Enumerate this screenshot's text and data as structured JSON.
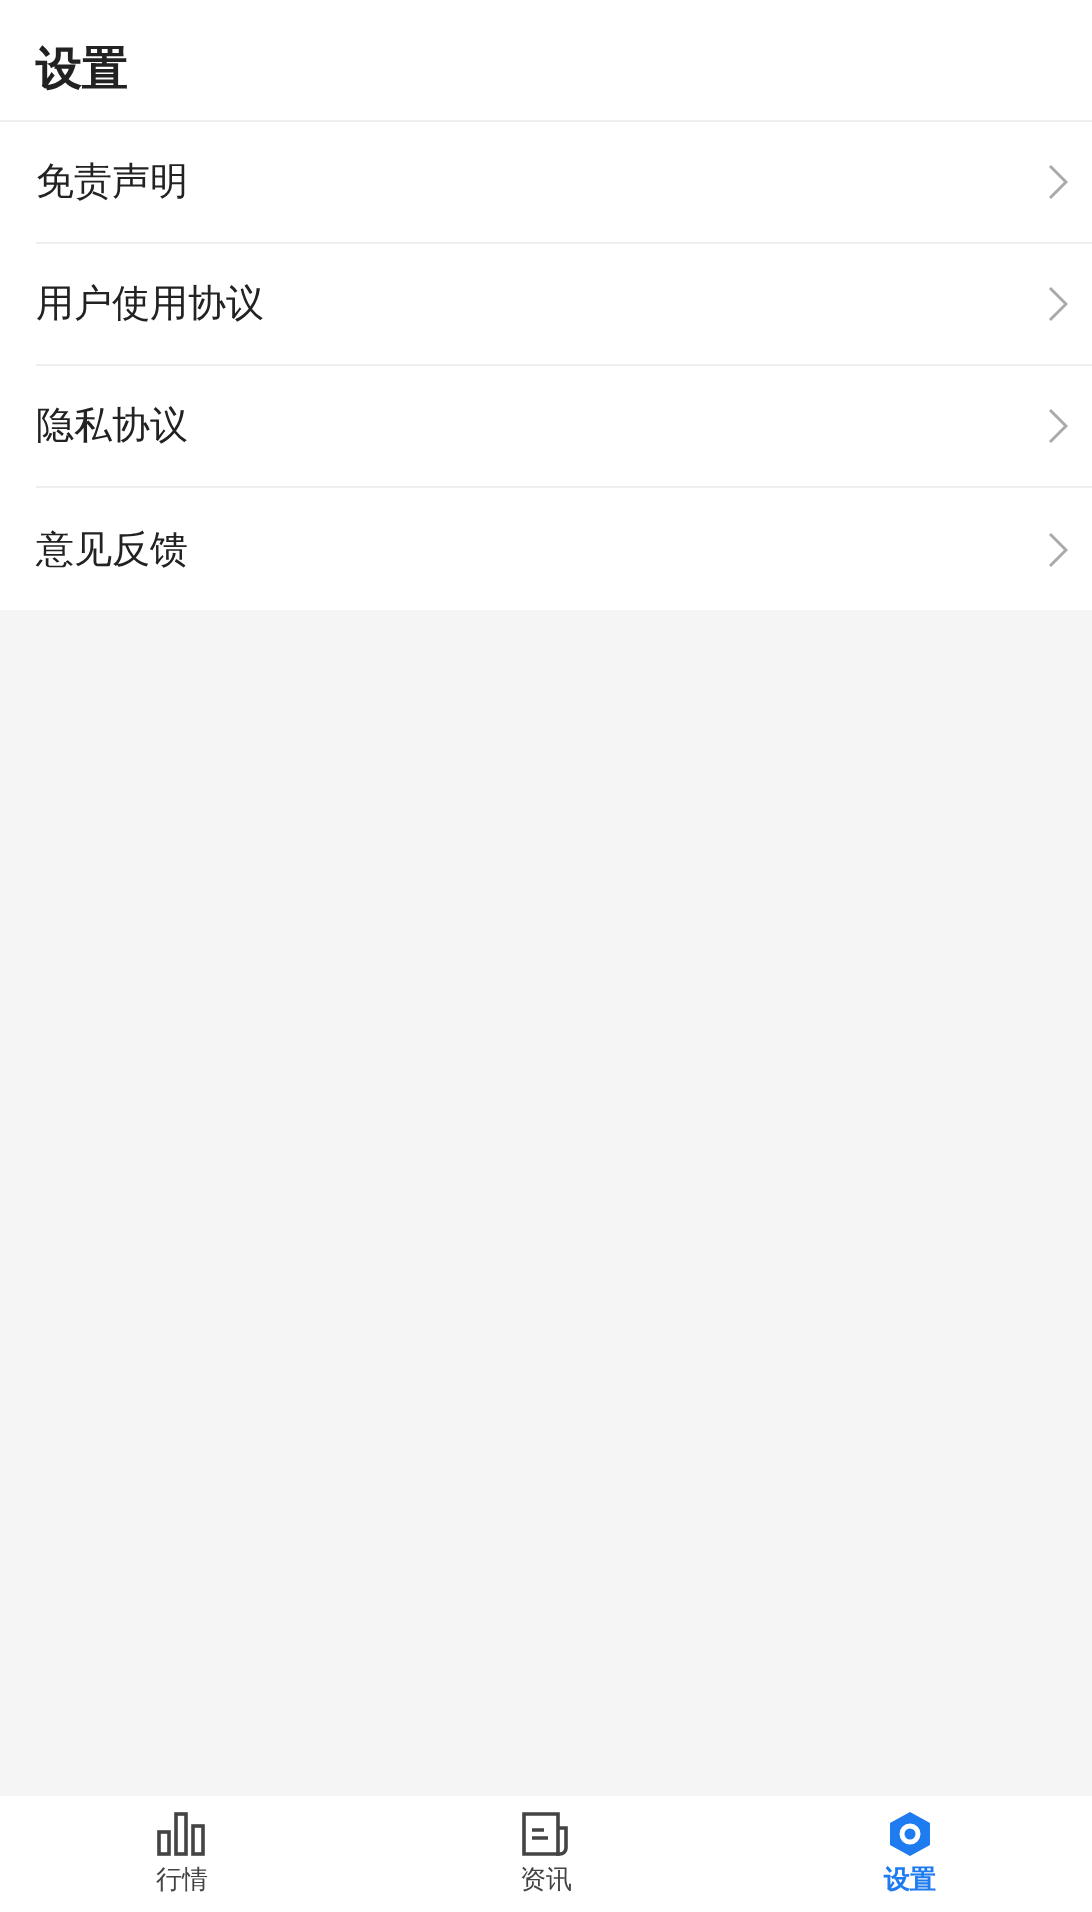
{
  "header": {
    "title": "设置"
  },
  "menu_items": [
    {
      "label": "免责声明"
    },
    {
      "label": "用户使用协议"
    },
    {
      "label": "隐私协议"
    },
    {
      "label": "意见反馈"
    }
  ],
  "tab_bar": [
    {
      "label": "行情",
      "selected": false
    },
    {
      "label": "资讯",
      "selected": false
    },
    {
      "label": "设置",
      "selected": true
    }
  ]
}
